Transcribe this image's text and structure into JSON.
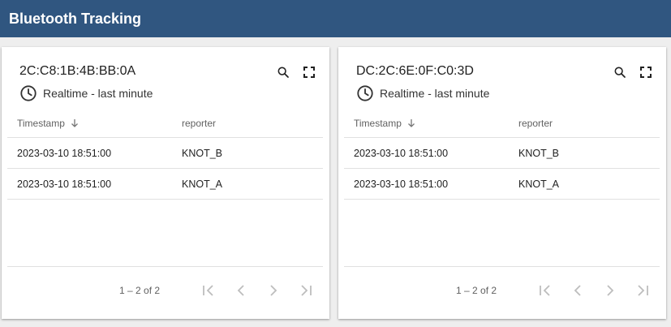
{
  "app": {
    "title": "Bluetooth Tracking"
  },
  "colors": {
    "header_bg": "#305680",
    "header_text": "#ffffff",
    "page_bg": "#eeeeee"
  },
  "cards": [
    {
      "device": "2C:C8:1B:4B:BB:0A",
      "subtitle": "Realtime - last minute",
      "icons": [
        "clock-icon",
        "search-icon",
        "fullscreen-icon"
      ],
      "columns": [
        "Timestamp",
        "reporter"
      ],
      "sort": {
        "column": "Timestamp",
        "direction": "descending"
      },
      "rows": [
        [
          "2023-03-10 18:51:00",
          "KNOT_B"
        ],
        [
          "2023-03-10 18:51:00",
          "KNOT_A"
        ]
      ],
      "range": "1 – 2 of 2"
    },
    {
      "device": "DC:2C:6E:0F:C0:3D",
      "subtitle": "Realtime - last minute",
      "icons": [
        "clock-icon",
        "search-icon",
        "fullscreen-icon"
      ],
      "columns": [
        "Timestamp",
        "reporter"
      ],
      "sort": {
        "column": "Timestamp",
        "direction": "descending"
      },
      "rows": [
        [
          "2023-03-10 18:51:00",
          "KNOT_B"
        ],
        [
          "2023-03-10 18:51:00",
          "KNOT_A"
        ]
      ],
      "range": "1 – 2 of 2"
    }
  ]
}
